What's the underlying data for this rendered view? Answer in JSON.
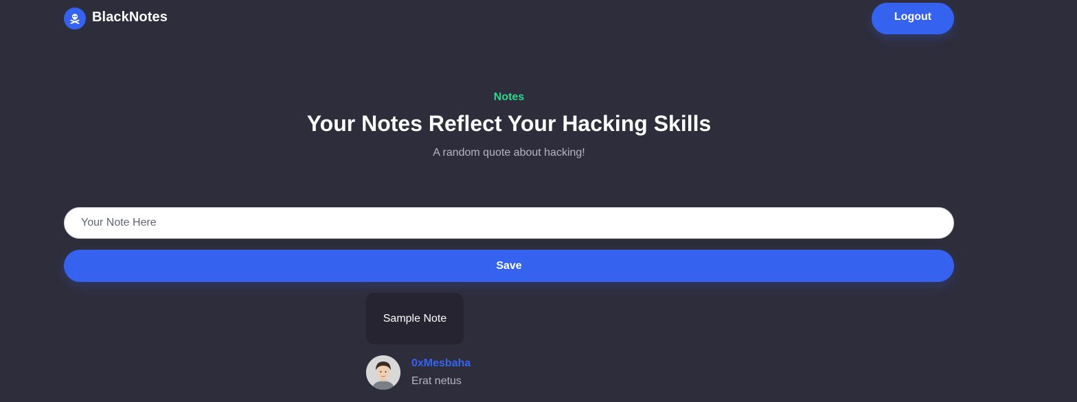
{
  "header": {
    "brand_name": "BlackNotes",
    "brand_icon": "skull-crossbones-icon",
    "logout_label": "Logout"
  },
  "hero": {
    "eyebrow": "Notes",
    "title": "Your Notes Reflect Your Hacking Skills",
    "subtitle": "A random quote about hacking!"
  },
  "form": {
    "note_placeholder": "Your Note Here",
    "note_value": "",
    "save_label": "Save"
  },
  "notes": [
    {
      "text": "Sample Note",
      "author": "0xMesbaha",
      "author_sub": "Erat netus"
    }
  ],
  "colors": {
    "background": "#2e2d3b",
    "accent": "#3563f0",
    "eyebrow": "#2bd98b",
    "card": "#252430"
  }
}
